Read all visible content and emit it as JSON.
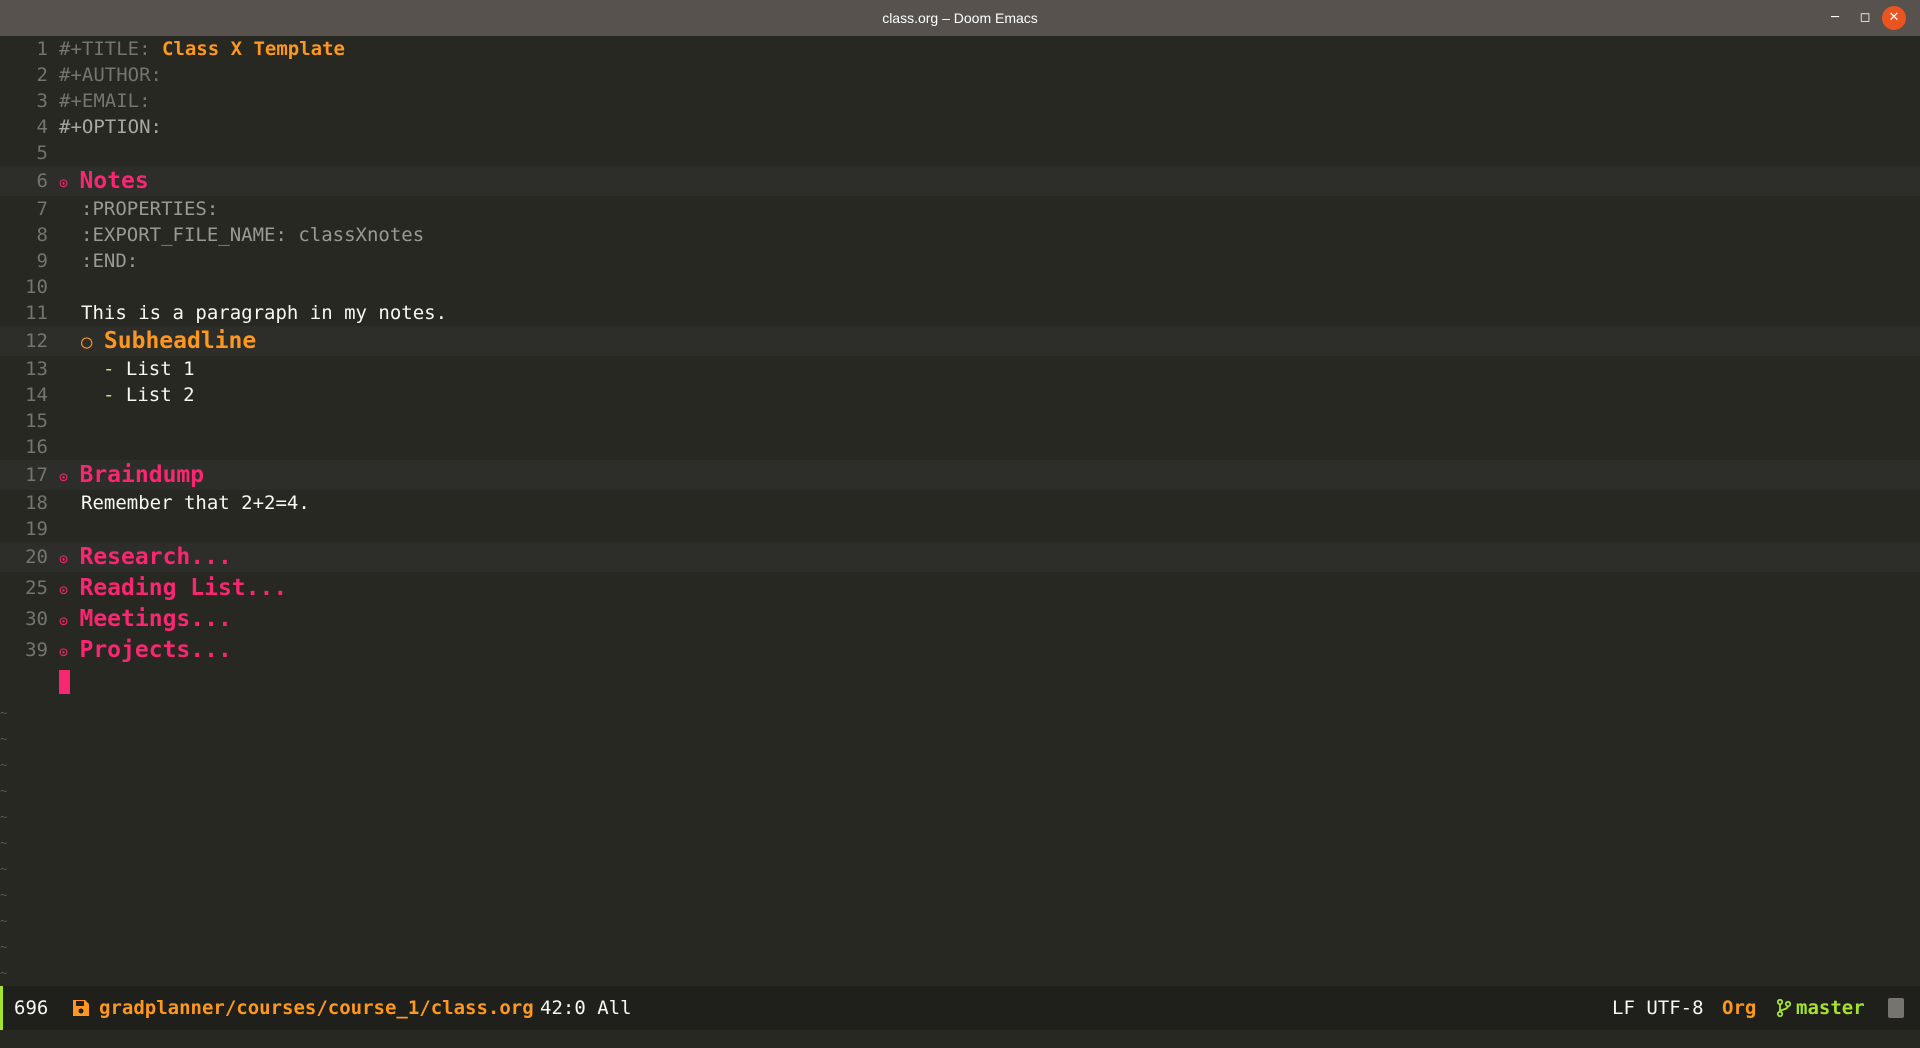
{
  "window": {
    "title": "class.org – Doom Emacs",
    "icons": {
      "minimize": "minimize-icon",
      "maximize": "maximize-icon",
      "close": "close-icon"
    },
    "colors": {
      "titlebar": "#57524e",
      "close_button": "#e95420",
      "editor_bg": "#272822"
    }
  },
  "editor": {
    "lines": [
      {
        "n": "1",
        "key": "#+TITLE:",
        "value": "Class X Template"
      },
      {
        "n": "2",
        "key": "#+AUTHOR:"
      },
      {
        "n": "3",
        "key": "#+EMAIL:"
      },
      {
        "n": "4",
        "key": "#+OPTION:"
      },
      {
        "n": "5"
      },
      {
        "n": "6",
        "heading": "Notes",
        "bullet": "⊙"
      },
      {
        "n": "7",
        "text": ":PROPERTIES:"
      },
      {
        "n": "8",
        "key": ":EXPORT_FILE_NAME:",
        "value": "classXnotes"
      },
      {
        "n": "9",
        "text": ":END:"
      },
      {
        "n": "10"
      },
      {
        "n": "11",
        "text": "This is a paragraph in my notes."
      },
      {
        "n": "12",
        "heading": "Subheadline",
        "bullet": "○"
      },
      {
        "n": "13",
        "dash": "-",
        "text": "List 1"
      },
      {
        "n": "14",
        "dash": "-",
        "text": "List 2"
      },
      {
        "n": "15"
      },
      {
        "n": "16"
      },
      {
        "n": "17",
        "heading": "Braindump",
        "bullet": "⊙"
      },
      {
        "n": "18",
        "text": "Remember that 2+2=4."
      },
      {
        "n": "19"
      },
      {
        "n": "20",
        "heading": "Research...",
        "bullet": "⊙"
      },
      {
        "n": "25",
        "heading": "Reading List...",
        "bullet": "⊙"
      },
      {
        "n": "30",
        "heading": "Meetings...",
        "bullet": "⊙"
      },
      {
        "n": "39",
        "heading": "Projects...",
        "bullet": "⊙"
      }
    ],
    "empty_line_marker": "~"
  },
  "modeline": {
    "line_count": "696",
    "save_icon": "save-icon",
    "file_path": "gradplanner/courses/course_1/class.org",
    "position": "42:0 All",
    "encoding": "LF UTF-8",
    "major_mode": "Org",
    "branch_icon": "git-branch-icon",
    "branch": "master",
    "alert_icon": "alert-icon",
    "colors": {
      "accent": "#a6e22e",
      "path": "#fd971f",
      "heading": "#f92672"
    }
  }
}
